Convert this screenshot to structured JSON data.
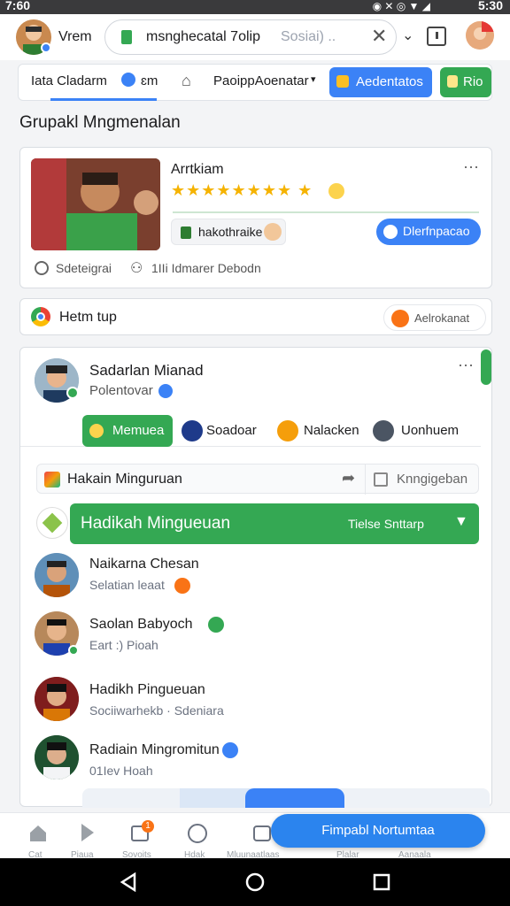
{
  "status_bar": {
    "time": "7:60",
    "right": "5:30"
  },
  "header": {
    "user_label": "Vrem",
    "url_text": "msnghecatal 7olip",
    "url_suffix": "Sosiai) ..",
    "more": "⌄"
  },
  "tabs": {
    "tab1": "Iata Cladarm",
    "tab1_suffix": "ɛm",
    "dropdown": "PaoippAoenatar",
    "blue_btn": "Aedentatos",
    "green_btn": "Rio"
  },
  "page_title": "Grupakl Mngmenalan",
  "featured": {
    "name": "Arrtkiam",
    "stars": "★★★★★★★★ ★",
    "tag": "hakothraike",
    "action": "Dlerfnpacao",
    "meta1": "Sdeteigrai",
    "meta2": "1IIi Idmarer Debodn"
  },
  "search_row": {
    "label": "Hetm tup",
    "action": "Aelrokanat"
  },
  "member_card": {
    "name": "Sadarlan Mianad",
    "role": "Polentovar",
    "chips": [
      "Memuea",
      "Soadoar",
      "Nalacken",
      "Uonhuem"
    ]
  },
  "filter_row": {
    "left": "Hakain Minguruan",
    "right": "Knngigeban"
  },
  "group_header": {
    "title": "Hadikah Mingueuan",
    "action": "Tielse Snttarp"
  },
  "members": [
    {
      "name": "Naikarna Chesan",
      "sub": "Selatian leaat",
      "badge_color": "#f97316"
    },
    {
      "name": "Saolan Babyoch",
      "sub": "Eart :) Pioah",
      "badge_color": "#34a853"
    },
    {
      "name": "Hadikh Pingueuan",
      "sub": "Sociiwarhekb · Sdeniara",
      "badge_color": ""
    },
    {
      "name": "Radiain Mingromitun",
      "sub": "01Iev Hoah",
      "badge_color": "#3b82f6"
    }
  ],
  "fab": "Fimpabl Nortumtaa",
  "bottom_nav": [
    "Cat",
    "Piaua",
    "Sovoits",
    "Hdak",
    "Mluunaatlaas",
    "Plalar",
    "Aanaala"
  ],
  "bottom_nav_badge": "1",
  "colors": {
    "accent": "#3b82f6",
    "green": "#34a853",
    "orange": "#f97316"
  }
}
